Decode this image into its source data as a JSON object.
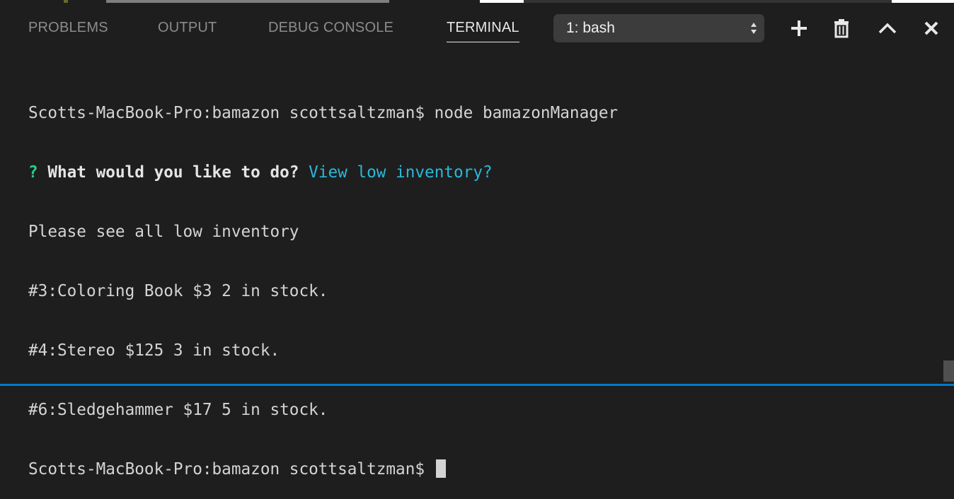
{
  "colors": {
    "background": "#1e1e1e",
    "tab_inactive": "#8c8c8c",
    "tab_active": "#e7e7e7",
    "prompt_green": "#23d18b",
    "answer_cyan": "#29b8db",
    "status_blue": "#007acc"
  },
  "tabs": {
    "problems": "PROBLEMS",
    "output": "OUTPUT",
    "debug_console": "DEBUG CONSOLE",
    "terminal": "TERMINAL"
  },
  "terminal_select": {
    "value": "1: bash"
  },
  "actions": {
    "new_terminal_icon": "plus-icon",
    "kill_terminal_icon": "trash-icon",
    "maximize_icon": "chevron-up-icon",
    "close_icon": "close-icon"
  },
  "terminal": {
    "line1": "Scotts-MacBook-Pro:bamazon scottsaltzman$ node bamazonManager",
    "line2_mark": "?",
    "line2_question": " What would you like to do?",
    "line2_answer": " View low inventory?",
    "line3": "Please see all low inventory",
    "line4": "#3:Coloring Book $3 2 in stock.",
    "line5": "#4:Stereo $125 3 in stock.",
    "line6": "#6:Sledgehammer $17 5 in stock.",
    "line7": "Scotts-MacBook-Pro:bamazon scottsaltzman$ "
  }
}
